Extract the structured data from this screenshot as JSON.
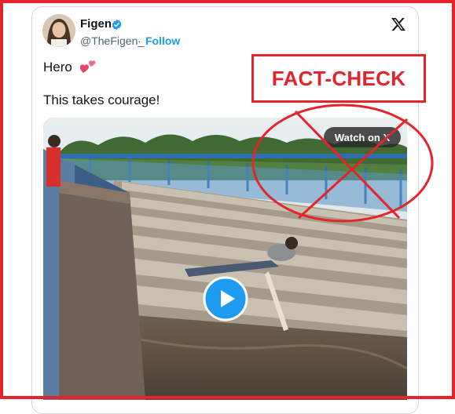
{
  "tweet": {
    "author_name": "Figen",
    "handle": "@TheFigen_",
    "separator": "·",
    "follow_label": "Follow",
    "text_line1": "Hero",
    "text_line2": "This takes courage!",
    "verified_icon": "verified-badge-icon",
    "platform_icon": "x-logo-icon",
    "heart_icon": "two-hearts-emoji"
  },
  "media": {
    "watch_label": "Watch on X",
    "play_icon": "play-icon"
  },
  "overlay": {
    "fact_check_label": "FACT-CHECK",
    "stamp_icon": "crossed-circle-icon",
    "color": "#e3242b"
  },
  "colors": {
    "link_blue": "#1d9bf0",
    "text_primary": "#0f1419",
    "text_secondary": "#536471",
    "frame_red": "#e3242b"
  }
}
